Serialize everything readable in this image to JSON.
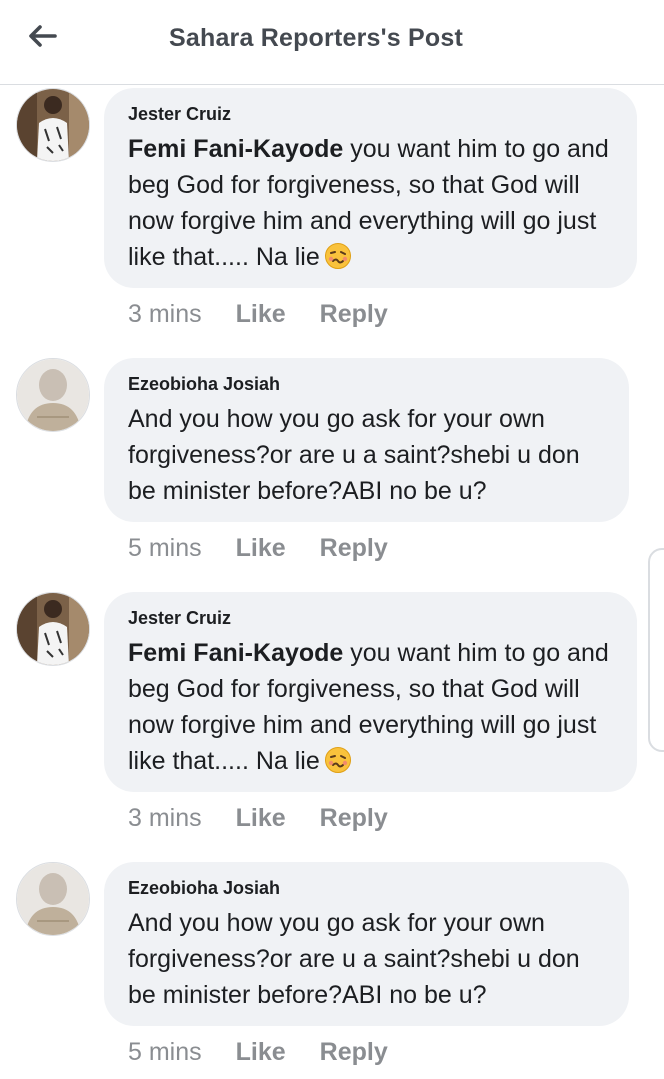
{
  "header": {
    "title": "Sahara Reporters's Post"
  },
  "comments": [
    {
      "author": "Jester Cruiz",
      "mention": "Femi Fani-Kayode",
      "text": " you want him to go and beg God for forgiveness, so that God will now forgive him and everything will go just like that..... Na lie",
      "emoji": "woozy-face-emoji",
      "time": "3 mins",
      "like": "Like",
      "reply": "Reply"
    },
    {
      "author": "Ezeobioha Josiah",
      "text": "And you how you go ask for your own forgiveness?or are u a saint?shebi u don be minister before?ABI no be u?",
      "time": "5 mins",
      "like": "Like",
      "reply": "Reply"
    },
    {
      "author": "Jester Cruiz",
      "mention": "Femi Fani-Kayode",
      "text": " you want him to go and beg God for forgiveness, so that God will now forgive him and everything will go just like that..... Na lie",
      "emoji": "woozy-face-emoji",
      "time": "3 mins",
      "like": "Like",
      "reply": "Reply"
    },
    {
      "author": "Ezeobioha Josiah",
      "text": "And you how you go ask for your own forgiveness?or are u a saint?shebi u don be minister before?ABI no be u?",
      "time": "5 mins",
      "like": "Like",
      "reply": "Reply"
    }
  ]
}
